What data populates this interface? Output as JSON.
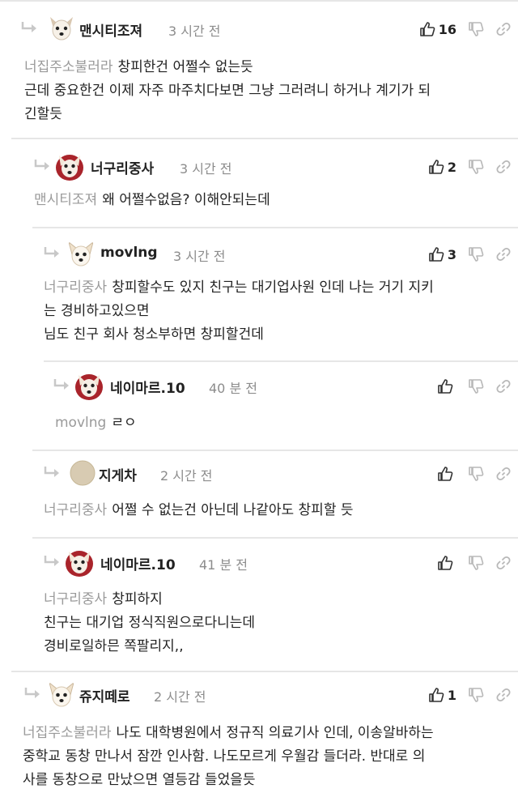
{
  "comments": [
    {
      "nick": "맨시티조져",
      "time": "3 시간 전",
      "likes": "16",
      "mention": "너집주소불러라",
      "lines": [
        "창피한건 어쩔수 없는듯",
        "근데 중요한건 이제 자주 마주치다보면 그냥 그러려니 하거나 계기가 되",
        "긴할듯"
      ]
    },
    {
      "nick": "너구리중사",
      "time": "3 시간 전",
      "likes": "2",
      "mention": "맨시티조져",
      "lines": [
        "왜 어쩔수없음? 이해안되는데"
      ]
    },
    {
      "nick": "movlng",
      "time": "3 시간 전",
      "likes": "3",
      "mention": "너구리중사",
      "lines": [
        "창피할수도 있지 친구는 대기업사원 인데 나는 거기 지키",
        "는 경비하고있으면",
        "님도 친구 회사 청소부하면 창피할건데"
      ]
    },
    {
      "nick": "네이마르.10",
      "time": "40 분 전",
      "likes": "",
      "mention": "movlng",
      "lines": [
        "ㄹㅇ"
      ]
    },
    {
      "nick": "지게차",
      "time": "2 시간 전",
      "likes": "",
      "mention": "너구리중사",
      "lines": [
        "어쩔 수 없는건 아닌데 나같아도 창피할 듯"
      ]
    },
    {
      "nick": "네이마르.10",
      "time": "41 분 전",
      "likes": "",
      "mention": "너구리중사",
      "lines": [
        "창피하지",
        "친구는 대기업 정식직원으로다니는데",
        "경비로일하믄 쪽팔리지,,"
      ]
    },
    {
      "nick": "쥬지떼로",
      "time": "2 시간 전",
      "likes": "1",
      "mention": "너집주소불러라",
      "lines": [
        "나도 대학병원에서 정규직 의료기사 인데, 이송알바하는",
        "중학교 동창 만나서 잠깐 인사함. 나도모르게 우월감 들더라. 반대로 의",
        "사를 동창으로 만났으면 열등감 들었을듯"
      ]
    }
  ]
}
